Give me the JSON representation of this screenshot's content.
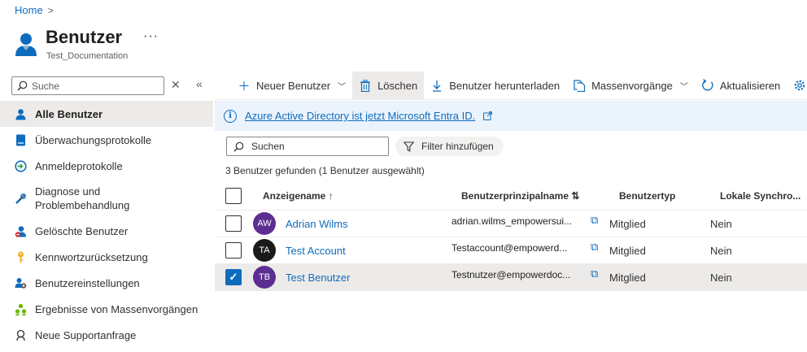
{
  "breadcrumb": {
    "home": "Home",
    "separator": ">"
  },
  "header": {
    "title": "Benutzer",
    "subtitle": "Test_Documentation",
    "more": "···"
  },
  "sidebar": {
    "search_placeholder": "Suche",
    "clear_glyph": "✕",
    "collapse_glyph": "«",
    "items": [
      {
        "label": "Alle Benutzer",
        "icon": "user-icon"
      },
      {
        "label": "Überwachungsprotokolle",
        "icon": "audit-log-icon"
      },
      {
        "label": "Anmeldeprotokolle",
        "icon": "sign-in-icon"
      },
      {
        "label": "Diagnose und Problembehandlung",
        "icon": "wrench-icon"
      },
      {
        "label": "Gelöschte Benutzer",
        "icon": "deleted-user-icon"
      },
      {
        "label": "Kennwortzurücksetzung",
        "icon": "key-icon"
      },
      {
        "label": "Benutzereinstellungen",
        "icon": "user-settings-icon"
      },
      {
        "label": "Ergebnisse von Massenvorgängen",
        "icon": "bulk-results-icon"
      },
      {
        "label": "Neue Supportanfrage",
        "icon": "support-icon"
      }
    ]
  },
  "toolbar": {
    "new_user": "Neuer Benutzer",
    "delete": "Löschen",
    "download": "Benutzer herunterladen",
    "bulk": "Massenvorgänge",
    "refresh": "Aktualisieren"
  },
  "banner": {
    "text": "Azure Active Directory ist jetzt Microsoft Entra ID."
  },
  "search": {
    "placeholder": "Suchen"
  },
  "filter": {
    "label": "Filter hinzufügen"
  },
  "result_count": "3 Benutzer gefunden (1 Benutzer ausgewählt)",
  "table": {
    "columns": {
      "display_name": "Anzeigename ↑",
      "upn": "Benutzerprinzipalname ⇅",
      "user_type": "Benutzertyp",
      "sync": "Lokale Synchro..."
    },
    "rows": [
      {
        "initials": "AW",
        "avatar_color": "#5c2e91",
        "name": "Adrian Wilms",
        "upn": "adrian.wilms_empowersui...",
        "type": "Mitglied",
        "sync": "Nein",
        "selected": false
      },
      {
        "initials": "TA",
        "avatar_color": "#1b1a19",
        "name": "Test Account",
        "upn": "Testaccount@empowerd...",
        "type": "Mitglied",
        "sync": "Nein",
        "selected": false
      },
      {
        "initials": "TB",
        "avatar_color": "#5c2e91",
        "name": "Test Benutzer",
        "upn": "Testnutzer@empowerdoc...",
        "type": "Mitglied",
        "sync": "Nein",
        "selected": true
      }
    ]
  },
  "colors": {
    "accent": "#0f6cbd",
    "selected_row": "#edebe9",
    "banner_bg": "#ebf3fc"
  }
}
